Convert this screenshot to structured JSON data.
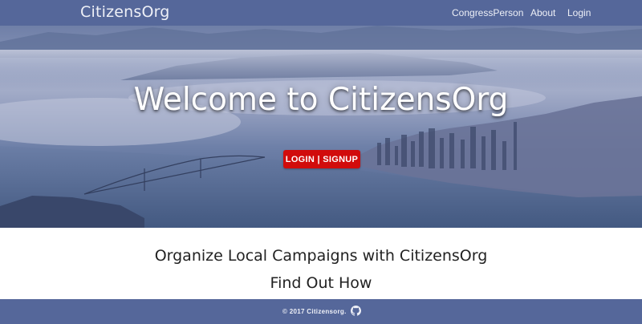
{
  "navbar": {
    "brand": "CitizensOrg",
    "links": [
      "CongressPerson",
      "About",
      "Login"
    ],
    "background": "#55679a"
  },
  "hero": {
    "title": "Welcome to CitizensOrg",
    "button_label": "LOGIN | SIGNUP",
    "button_color": "#d10c0c"
  },
  "main": {
    "tagline": "Organize Local Campaigns with CitizensOrg",
    "cta": "Find Out How"
  },
  "footer": {
    "copyright": "© 2017 Citizensorg.",
    "icon": "github-icon",
    "background": "#55679a"
  }
}
